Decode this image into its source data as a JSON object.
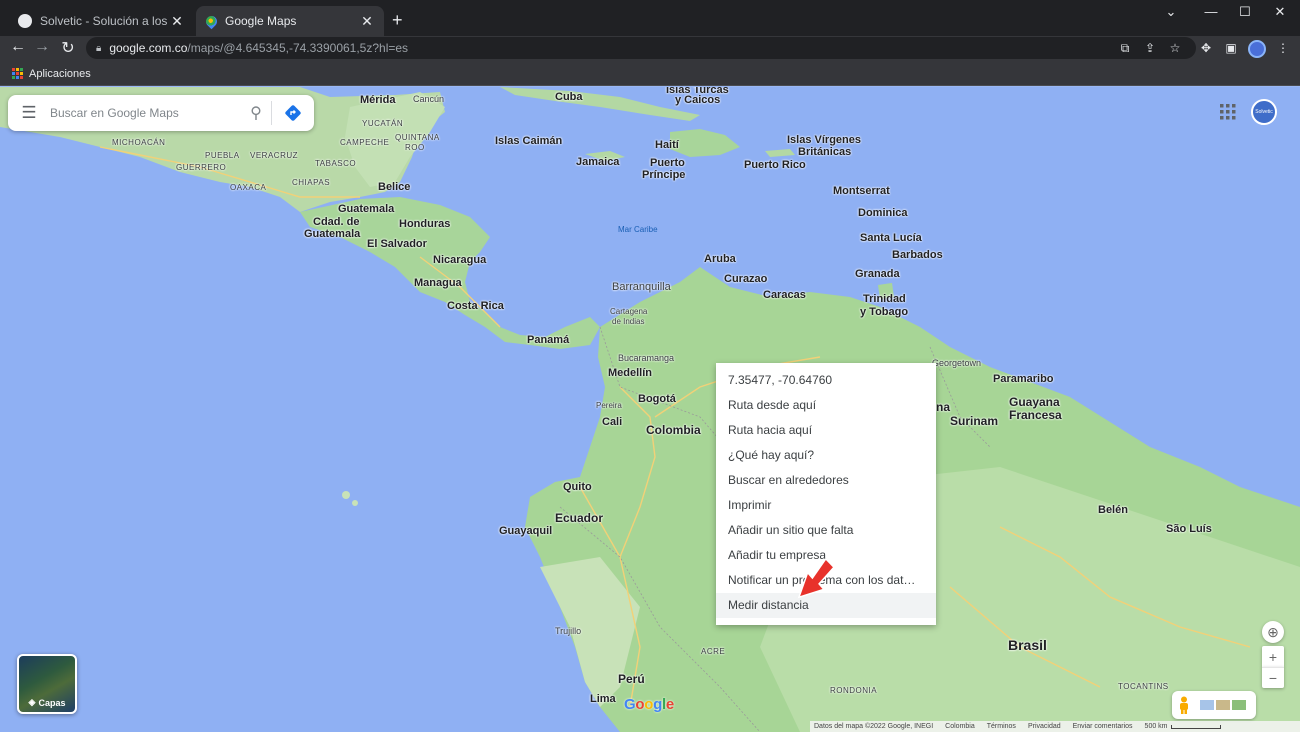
{
  "browser": {
    "tabs": [
      {
        "title": "Solvetic - Solución a los problemas",
        "favicon": "solvetic-icon",
        "active": false
      },
      {
        "title": "Google Maps",
        "favicon": "google-maps-icon",
        "active": true
      }
    ],
    "new_tab": "+",
    "window_controls": [
      "chevron-down-icon",
      "minimize-icon",
      "maximize-icon",
      "close-icon"
    ],
    "url_host": "google.com.co",
    "url_path": "/maps/@4.645345,-74.3390061,5z?hl=es",
    "bookmarks": [
      {
        "label": "Aplicaciones",
        "icon": "apps-grid-icon"
      }
    ],
    "toolbar_icons": [
      "install-icon",
      "share-icon",
      "star-icon",
      "extensions-icon",
      "sidepanel-icon",
      "profile-avatar",
      "more-vert-icon"
    ]
  },
  "map": {
    "search_placeholder": "Buscar en Google Maps",
    "account_label": "Solvetic",
    "context_menu": [
      "7.35477, -70.64760",
      "Ruta desde aquí",
      "Ruta hacia aquí",
      "¿Qué hay aquí?",
      "Buscar en alrededores",
      "Imprimir",
      "Añadir un sitio que falta",
      "Añadir tu empresa",
      "Notificar un problema con los dat…",
      "Medir distancia"
    ],
    "highlighted_item": "Medir distancia",
    "layers_label": "Capas",
    "zoom_in": "+",
    "zoom_out": "−",
    "google_logo": [
      "G",
      "o",
      "o",
      "g",
      "l",
      "e"
    ],
    "google_logo_colors": [
      "#4285f4",
      "#ea4335",
      "#fbbc05",
      "#4285f4",
      "#34a853",
      "#ea4335"
    ],
    "footer": [
      "Datos del mapa ©2022 Google, INEGI",
      "Colombia",
      "Términos",
      "Privacidad",
      "Enviar comentarios",
      "500 km"
    ],
    "labels": {
      "merida": "Mérida",
      "cancun": "Cancún",
      "cuba": "Cuba",
      "turcas_1": "Islas Turcas",
      "turcas_2": "y Caicos",
      "yucatan": "YUCATÁN",
      "campeche": "CAMPECHE",
      "quintana_1": "QUINTANA",
      "quintana_2": "ROO",
      "michoacan": "MICHOACÁN",
      "puebla": "PUEBLA",
      "veracruz": "VERACRUZ",
      "guerrero": "GUERRERO",
      "tabasco": "TABASCO",
      "oaxaca": "OAXACA",
      "chiapas": "CHIAPAS",
      "caiman": "Islas Caimán",
      "haiti": "Haití",
      "jamaica": "Jamaica",
      "puerto_principe_1": "Puerto",
      "puerto_principe_2": "Príncipe",
      "virgenes_1": "Islas Vírgenes",
      "virgenes_2": "Británicas",
      "puerto_rico": "Puerto Rico",
      "belice": "Belice",
      "montserrat": "Montserrat",
      "dominica": "Dominica",
      "santa_lucia": "Santa Lucía",
      "barbados": "Barbados",
      "granada": "Granada",
      "guatemala": "Guatemala",
      "cdad_1": "Cdad. de",
      "cdad_2": "Guatemala",
      "honduras": "Honduras",
      "el_salvador": "El Salvador",
      "mar_caribe": "Mar Caribe",
      "nicaragua": "Nicaragua",
      "managua": "Managua",
      "costa_rica": "Costa Rica",
      "aruba": "Aruba",
      "curazao": "Curazao",
      "caracas": "Caracas",
      "barranquilla": "Barranquilla",
      "cartagena_1": "Cartagena",
      "cartagena_2": "de Indias",
      "trinidad_1": "Trinidad",
      "trinidad_2": "y Tobago",
      "panama": "Panamá",
      "bucaramanga": "Bucaramanga",
      "georgetown": "Georgetown",
      "paramaribo": "Paramaribo",
      "medellin": "Medellín",
      "pereira": "Pereira",
      "bogota": "Bogotá",
      "colombia": "Colombia",
      "cali": "Cali",
      "guyana_cut": "na",
      "guayana_1": "Guayana",
      "guayana_2": "Francesa",
      "surinam": "Surinam",
      "quito": "Quito",
      "guayaquil": "Guayaquil",
      "ecuador": "Ecuador",
      "belen": "Belén",
      "sao_luis": "São Luís",
      "trujillo": "Trujillo",
      "acre": "ACRE",
      "brasil": "Brasil",
      "lima": "Lima",
      "peru": "Perú",
      "rondonia": "RONDONIA",
      "tocantins": "TOCANTINS"
    }
  }
}
